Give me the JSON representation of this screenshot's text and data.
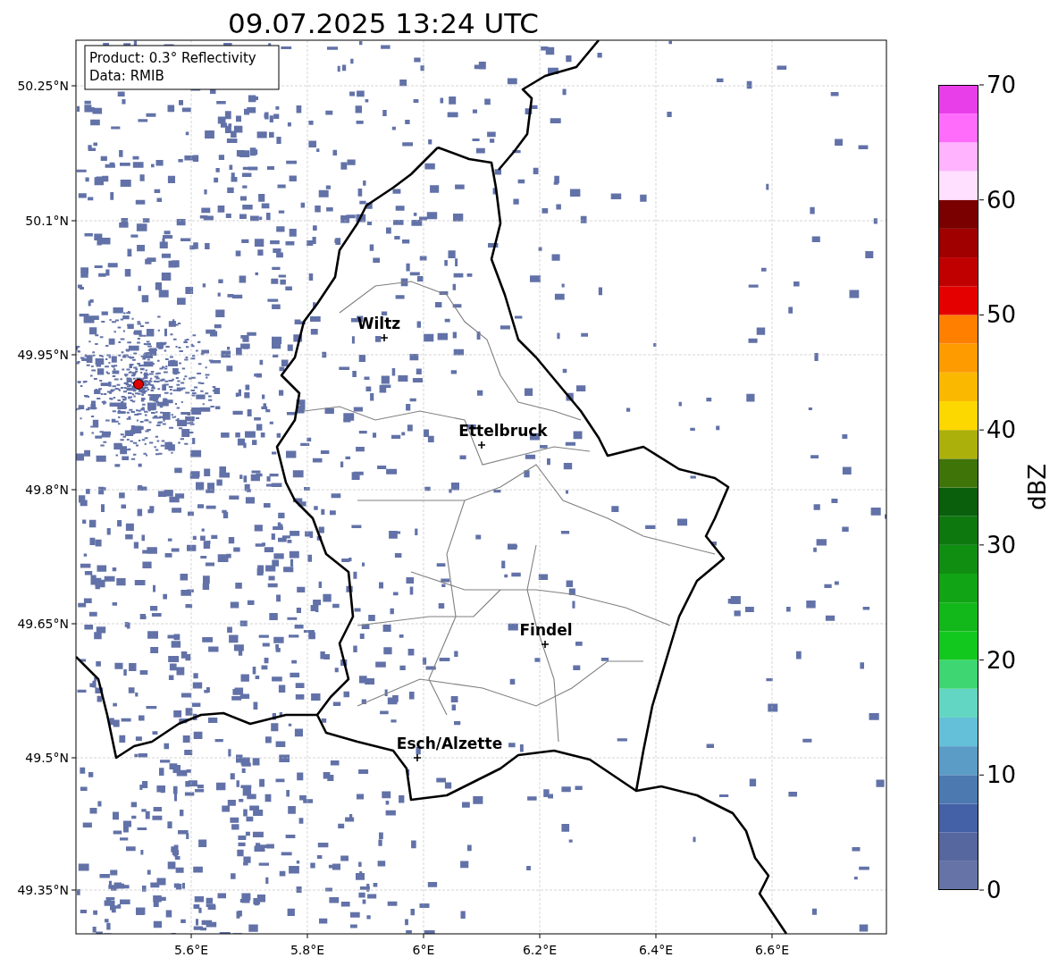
{
  "title": "09.07.2025 13:24 UTC",
  "info_box": {
    "lines": [
      "Product: 0.3° Reflectivity",
      "Data: RMIB"
    ]
  },
  "map": {
    "x_tick_labels": [
      "5.6°E",
      "5.8°E",
      "6°E",
      "6.2°E",
      "6.4°E",
      "6.6°E"
    ],
    "y_tick_labels": [
      "50.25°N",
      "50.1°N",
      "49.95°N",
      "49.8°N",
      "49.65°N",
      "49.5°N",
      "49.35°N"
    ],
    "places": [
      {
        "name": "Wiltz"
      },
      {
        "name": "Ettelbruck"
      },
      {
        "name": "Findel"
      },
      {
        "name": "Esch/Alzette"
      }
    ]
  },
  "colorbar": {
    "label": "dBZ",
    "tick_labels": [
      "70",
      "60",
      "50",
      "40",
      "30",
      "20",
      "10",
      "0"
    ]
  }
}
